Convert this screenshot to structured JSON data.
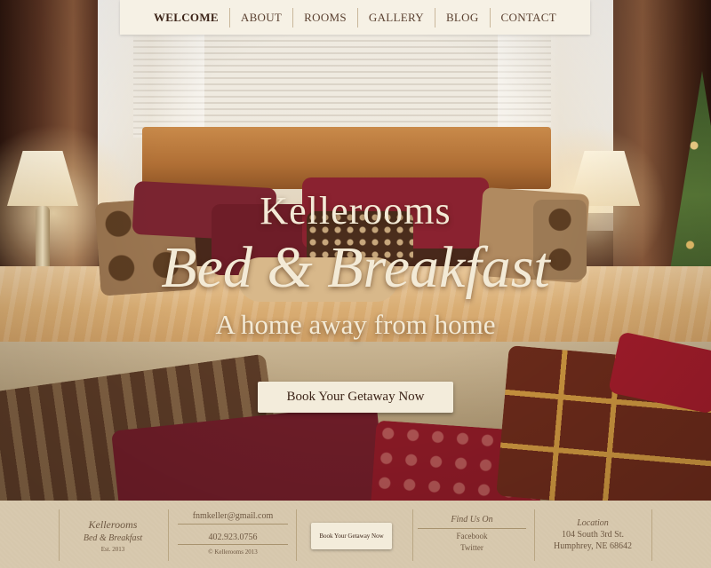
{
  "nav": {
    "items": [
      {
        "label": "WELCOME",
        "active": true
      },
      {
        "label": "ABOUT",
        "active": false
      },
      {
        "label": "ROOMS",
        "active": false
      },
      {
        "label": "GALLERY",
        "active": false
      },
      {
        "label": "BLOG",
        "active": false
      },
      {
        "label": "CONTACT",
        "active": false
      }
    ]
  },
  "hero": {
    "title": "Kellerooms",
    "subtitle": "Bed & Breakfast",
    "tagline": "A home away from home",
    "cta_label": "Book Your Getaway Now"
  },
  "footer": {
    "brand": {
      "name": "Kellerooms",
      "sub": "Bed & Breakfast",
      "est": "Est. 2013"
    },
    "contact": {
      "email": "fnmkeller@gmail.com",
      "phone": "402.923.0756",
      "copyright": "© Kellerooms 2013"
    },
    "cta_label": "Book Your Getaway Now",
    "social": {
      "heading": "Find Us On",
      "links": [
        "Facebook",
        "Twitter"
      ]
    },
    "location": {
      "heading": "Location",
      "line1": "104 South 3rd St.",
      "line2": "Humphrey, NE 68642"
    }
  },
  "colors": {
    "cream": "#f6f1e5",
    "text_brown": "#5a4030",
    "footer_bg": "#d6c7ac"
  }
}
